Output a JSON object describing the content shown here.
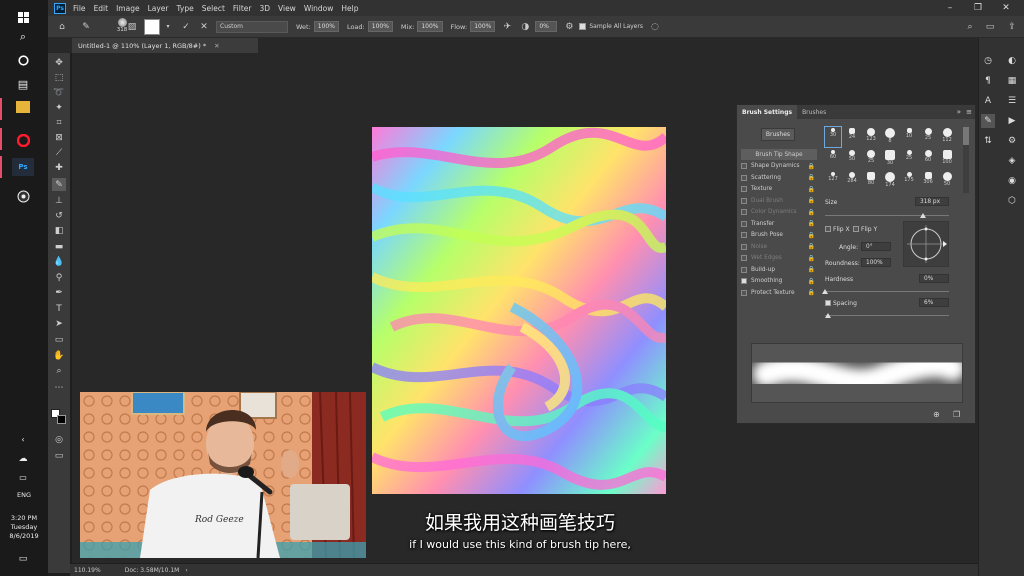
{
  "taskbar": {
    "time": "3:20 PM",
    "day": "Tuesday",
    "date": "8/6/2019",
    "lang": "ENG"
  },
  "menubar": {
    "logo": "Ps",
    "items": [
      "File",
      "Edit",
      "Image",
      "Layer",
      "Type",
      "Select",
      "Filter",
      "3D",
      "View",
      "Window",
      "Help"
    ]
  },
  "options": {
    "brush_size": "318",
    "preset": "Custom",
    "wet_label": "Wet:",
    "wet": "100%",
    "load_label": "Load:",
    "load": "100%",
    "mix_label": "Mix:",
    "mix": "100%",
    "flow_label": "Flow:",
    "flow": "100%",
    "angle": "0%",
    "sample_label": "Sample All Layers"
  },
  "document": {
    "tab_title": "Untitled-1 @ 110% (Layer 1, RGB/8#) *",
    "zoom": "110.19%",
    "doc_info": "Doc: 3.58M/10.1M"
  },
  "panel": {
    "tabs": [
      "Brush Settings",
      "Brushes"
    ],
    "brushes_button": "Brushes",
    "list": [
      {
        "label": "Brush Tip Shape",
        "checked": false,
        "disabled": false,
        "selected": true,
        "lock": false
      },
      {
        "label": "Shape Dynamics",
        "checked": false,
        "disabled": false,
        "selected": false,
        "lock": true
      },
      {
        "label": "Scattering",
        "checked": false,
        "disabled": false,
        "selected": false,
        "lock": true
      },
      {
        "label": "Texture",
        "checked": false,
        "disabled": false,
        "selected": false,
        "lock": true
      },
      {
        "label": "Dual Brush",
        "checked": false,
        "disabled": true,
        "selected": false,
        "lock": true
      },
      {
        "label": "Color Dynamics",
        "checked": false,
        "disabled": true,
        "selected": false,
        "lock": true
      },
      {
        "label": "Transfer",
        "checked": false,
        "disabled": false,
        "selected": false,
        "lock": true
      },
      {
        "label": "Brush Pose",
        "checked": false,
        "disabled": false,
        "selected": false,
        "lock": true
      },
      {
        "label": "Noise",
        "checked": false,
        "disabled": true,
        "selected": false,
        "lock": true
      },
      {
        "label": "Wet Edges",
        "checked": false,
        "disabled": true,
        "selected": false,
        "lock": true
      },
      {
        "label": "Build-up",
        "checked": false,
        "disabled": false,
        "selected": false,
        "lock": true
      },
      {
        "label": "Smoothing",
        "checked": true,
        "disabled": false,
        "selected": false,
        "lock": true
      },
      {
        "label": "Protect Texture",
        "checked": false,
        "disabled": false,
        "selected": false,
        "lock": true
      }
    ],
    "tips": [
      "30",
      "24",
      "123",
      "8",
      "10",
      "25",
      "112",
      "60",
      "50",
      "25",
      "30",
      "25",
      "60",
      "100",
      "127",
      "284",
      "80",
      "174",
      "175",
      "306",
      "50"
    ],
    "size_label": "Size",
    "size_value": "318 px",
    "flipx_label": "Flip X",
    "flipy_label": "Flip Y",
    "angle_label": "Angle:",
    "angle_value": "0°",
    "roundness_label": "Roundness:",
    "roundness_value": "100%",
    "hardness_label": "Hardness",
    "hardness_value": "0%",
    "spacing_label": "Spacing",
    "spacing_value": "6%"
  },
  "subtitles": {
    "chinese": "如果我用这种画笔技巧",
    "english": "if I would use this kind of brush tip here,"
  },
  "webcam": {
    "shirt_text": "Rod Geeze"
  }
}
